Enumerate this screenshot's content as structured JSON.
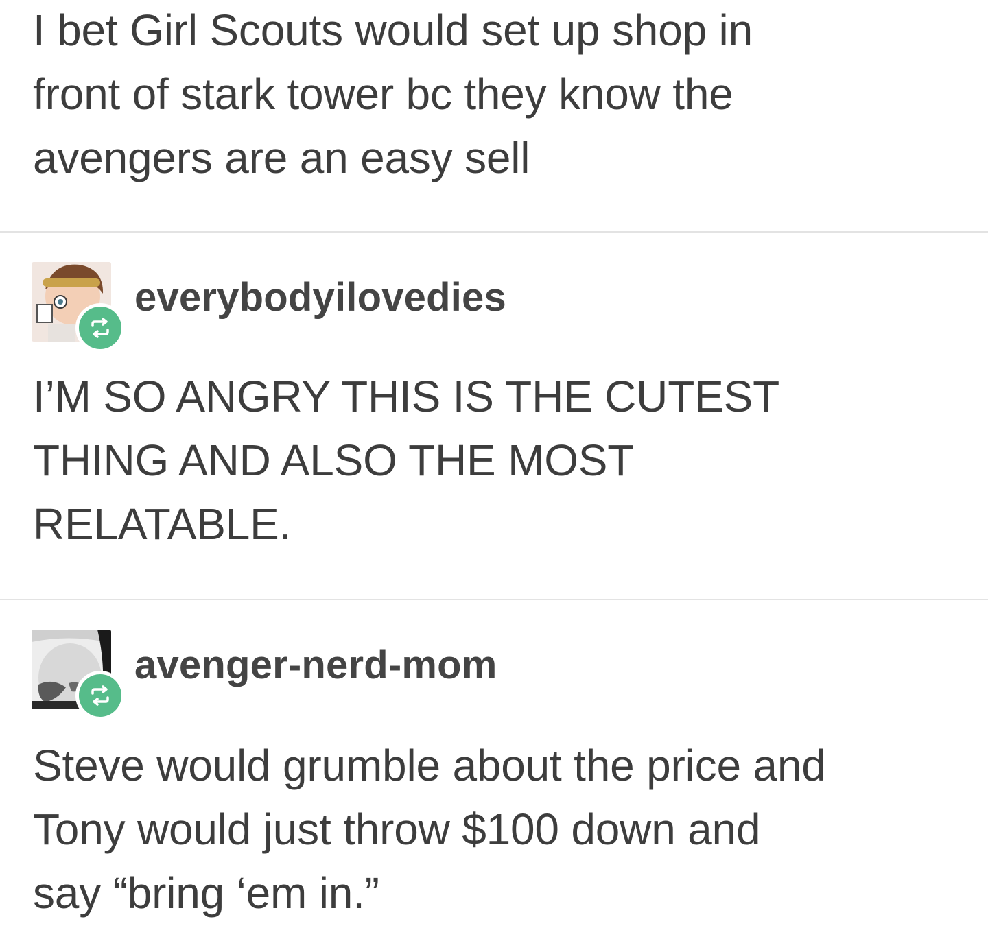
{
  "posts": {
    "original": {
      "text": "I bet Girl Scouts would set up shop in\nfront of stark tower bc they know the\navengers are an easy sell"
    },
    "reblogs": [
      {
        "username": "everybodyilovedies",
        "text": "I’M SO ANGRY THIS IS THE CUTEST\nTHING AND ALSO THE MOST\nRELATABLE.",
        "badge_icon": "reblog-icon"
      },
      {
        "username": "avenger-nerd-mom",
        "text": "Steve would grumble about the price and\nTony would just throw $100 down and\nsay “bring ‘em in.”",
        "badge_icon": "reblog-icon"
      }
    ]
  },
  "colors": {
    "text": "#3d3d3d",
    "divider": "#e3e3e3",
    "reblog_badge": "#56bc8a"
  }
}
